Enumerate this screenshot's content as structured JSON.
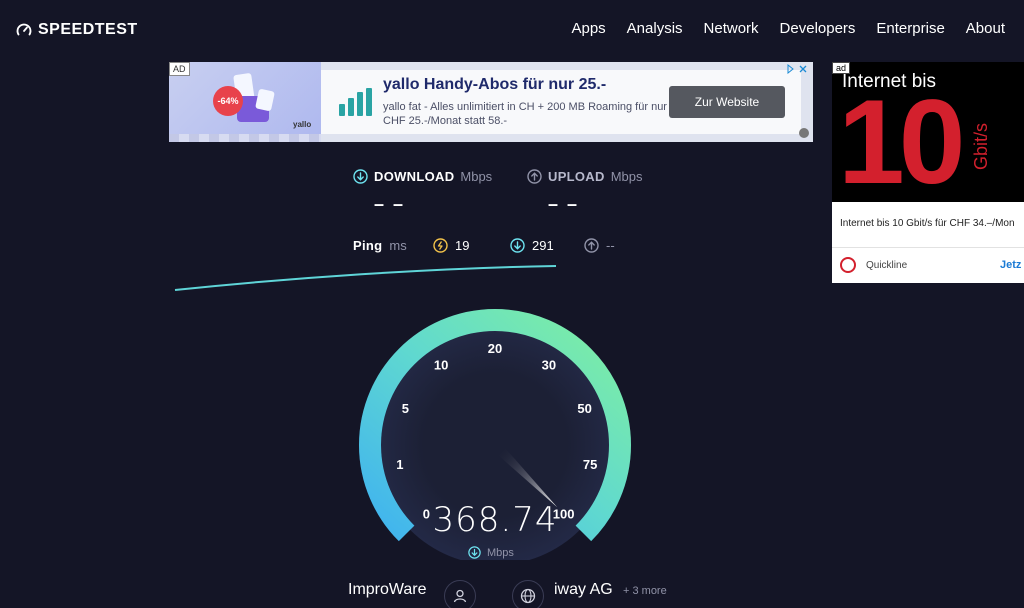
{
  "header": {
    "logo_text": "SPEEDTEST",
    "nav": [
      "Apps",
      "Analysis",
      "Network",
      "Developers",
      "Enterprise",
      "About"
    ]
  },
  "banner_ad": {
    "tag": "AD",
    "promo_badge": "-64%",
    "brand": "yallo",
    "title": "yallo Handy-Abos für nur 25.-",
    "description": "yallo fat - Alles unlimitiert in CH + 200 MB Roaming für nur CHF 25.-/Monat statt 58.-",
    "cta": "Zur Website",
    "choices_icon": "ad-choices-icon",
    "close_icon": "close-icon"
  },
  "side_ad": {
    "tag": "ad",
    "headline": "Internet bis",
    "big_number": "10",
    "unit": "Gbit/s",
    "text": "Internet bis 10 Gbit/s für CHF 34.–/Mon",
    "brand": "Quickline",
    "cta": "Jetz"
  },
  "download": {
    "label": "DOWNLOAD",
    "unit": "Mbps",
    "value": "– –",
    "icon": "download-arrow-icon",
    "color": "#6ee3f0"
  },
  "upload": {
    "label": "UPLOAD",
    "unit": "Mbps",
    "value": "– –",
    "icon": "upload-arrow-icon",
    "color": "#9193a8"
  },
  "ping": {
    "label": "Ping",
    "unit": "ms",
    "idle": "19",
    "download": "291",
    "upload": "--",
    "idle_color": "#f2c24a",
    "download_color": "#6ee3f0",
    "upload_color": "#9193a8"
  },
  "gauge": {
    "ticks": [
      "0",
      "1",
      "5",
      "10",
      "20",
      "30",
      "50",
      "75",
      "100"
    ],
    "current_value": "368.74",
    "unit": "Mbps",
    "needle_fraction": 1.0,
    "gradient_start": "#3fb2f0",
    "gradient_end": "#80f0a0"
  },
  "footer": {
    "isp": "ImproWare",
    "server": "iway AG",
    "server_more": "+ 3 more"
  }
}
